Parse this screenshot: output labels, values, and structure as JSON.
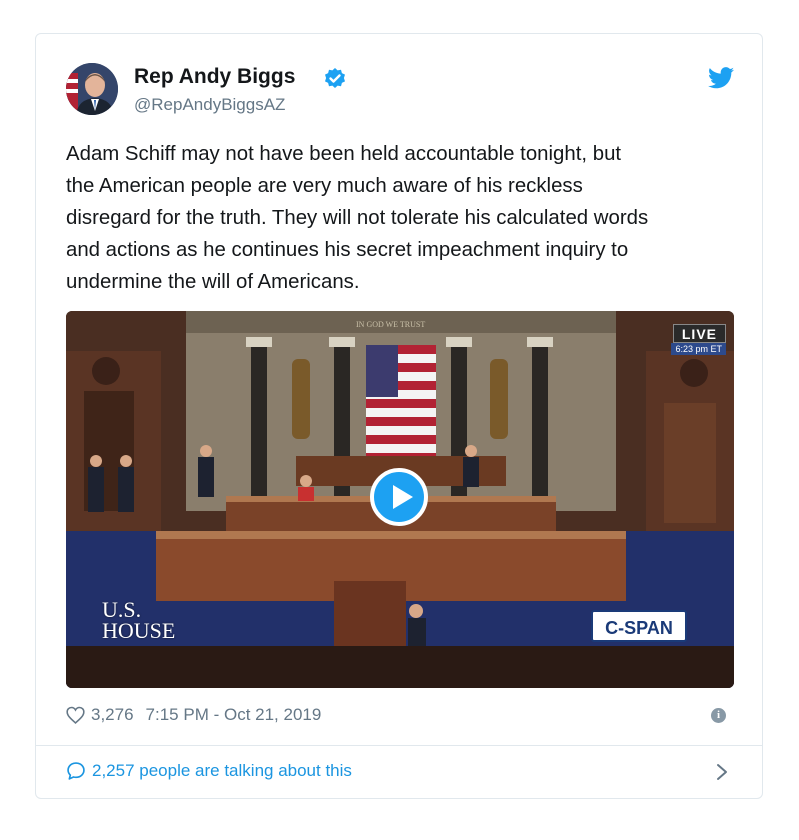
{
  "author": {
    "display_name": "Rep Andy Biggs",
    "handle": "@RepAndyBiggsAZ",
    "verified": true
  },
  "tweet": {
    "text_lines": [
      "Adam Schiff may not have been held accountable tonight, but",
      "the American people are very much aware of his reckless",
      "disregard for the truth. They will not tolerate his calculated words",
      "and actions as he continues his secret impeachment inquiry to",
      "undermine the will of Americans."
    ]
  },
  "media": {
    "live_label": "LIVE",
    "live_time": "6:23 pm ET",
    "house_logo_line1": "U.S.",
    "house_logo_line2": "HOUSE",
    "network_logo": "C-SPAN",
    "wall_inscription": "IN GOD WE TRUST"
  },
  "meta": {
    "likes": "3,276",
    "timestamp": "7:15 PM - Oct 21, 2019"
  },
  "conversation": {
    "label": "2,257 people are talking about this"
  },
  "colors": {
    "brand_blue": "#1da1f2",
    "link_blue": "#1b95e0",
    "secondary_text": "#657786",
    "border": "#e1e8ed"
  },
  "icons": [
    "avatar",
    "verified-badge-icon",
    "twitter-bird-icon",
    "play-icon",
    "heart-icon",
    "info-icon",
    "speech-bubble-icon",
    "chevron-right-icon"
  ]
}
